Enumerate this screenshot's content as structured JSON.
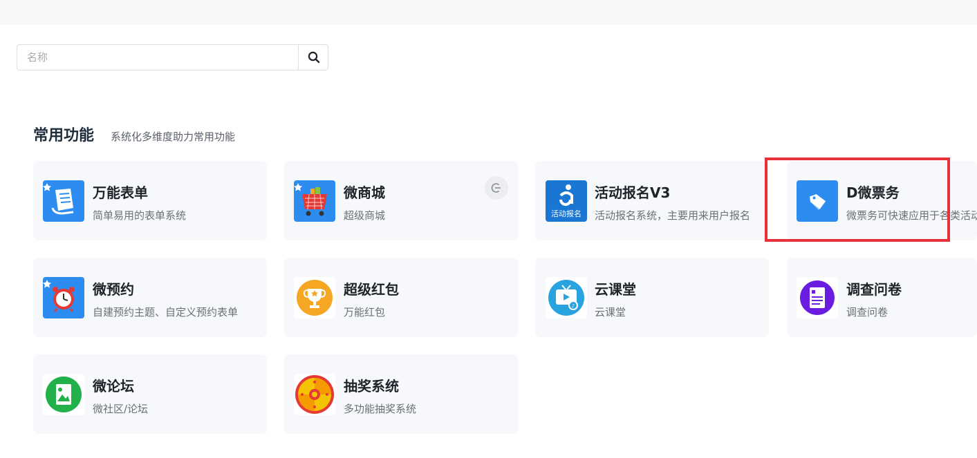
{
  "search": {
    "placeholder": "名称",
    "icon": "search-icon"
  },
  "section": {
    "title": "常用功能",
    "subtitle": "系统化多维度助力常用功能"
  },
  "cards": [
    {
      "title": "万能表单",
      "desc": "简单易用的表单系统",
      "icon": "form-icon",
      "color": "#2d8cf0"
    },
    {
      "title": "微商城",
      "desc": "超级商城",
      "icon": "shopping-cart-icon",
      "color": "#2d8cf0"
    },
    {
      "title": "活动报名V3",
      "desc": "活动报名系统，主要用来用户报名",
      "icon": "activity-signup-icon",
      "icon_text": "活动报名",
      "color": "#1976d2"
    },
    {
      "title": "D微票务",
      "desc": "微票务可快速应用于各类活动",
      "icon": "ticket-tag-icon",
      "color": "#2d8cf0"
    },
    {
      "title": "微预约",
      "desc": "自建预约主题、自定义预约表单",
      "icon": "alarm-clock-icon",
      "color": "#2d8cf0"
    },
    {
      "title": "超级红包",
      "desc": "万能红包",
      "icon": "trophy-icon",
      "color": "#f5a623"
    },
    {
      "title": "云课堂",
      "desc": "云课堂",
      "icon": "tv-classroom-icon",
      "color": "#29a3e0"
    },
    {
      "title": "调查问卷",
      "desc": "调查问卷",
      "icon": "survey-document-icon",
      "color": "#6a1de0"
    },
    {
      "title": "微论坛",
      "desc": "微社区/论坛",
      "icon": "forum-image-icon",
      "color": "#22b04b"
    },
    {
      "title": "抽奖系统",
      "desc": "多功能抽奖系统",
      "icon": "lottery-wheel-icon",
      "color": "#e53935"
    }
  ],
  "more_icon": "logout-circle-icon"
}
